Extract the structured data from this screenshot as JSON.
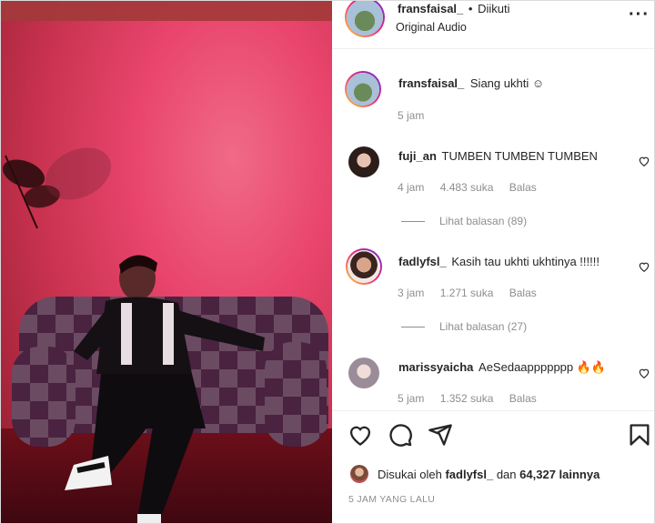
{
  "header": {
    "username": "fransfaisal_",
    "dot": "•",
    "follow_status": "Diikuti",
    "audio": "Original Audio",
    "more_icon": "more-horizontal-icon"
  },
  "caption": {
    "username": "fransfaisal_",
    "text": "Siang ukhti",
    "emoji": "☺",
    "time": "5 jam"
  },
  "comments": [
    {
      "username": "fuji_an",
      "text": "TUMBEN TUMBEN TUMBEN",
      "time": "4 jam",
      "likes": "4.483 suka",
      "reply": "Balas",
      "view_replies": "Lihat balasan (89)"
    },
    {
      "username": "fadlyfsl_",
      "text": "Kasih tau ukhti ukhtinya !!!!!!",
      "time": "3 jam",
      "likes": "1.271 suka",
      "reply": "Balas",
      "view_replies": "Lihat balasan (27)"
    },
    {
      "username": "marissyaicha",
      "text": "AeSedaappppppp 🔥🔥",
      "time": "5 jam",
      "likes": "1.352 suka",
      "reply": "Balas"
    }
  ],
  "actions": {
    "like_icon": "heart-icon",
    "comment_icon": "comment-icon",
    "share_icon": "send-icon",
    "save_icon": "bookmark-icon"
  },
  "likes_line": {
    "prefix": "Disukai oleh",
    "user": "fadlyfsl_",
    "middle": "dan",
    "count": "64,327 lainnya"
  },
  "posted_ago": "5 JAM YANG LALU",
  "colors": {
    "text": "#262626",
    "secondary": "#8e8e8e",
    "border": "#dbdbdb"
  }
}
